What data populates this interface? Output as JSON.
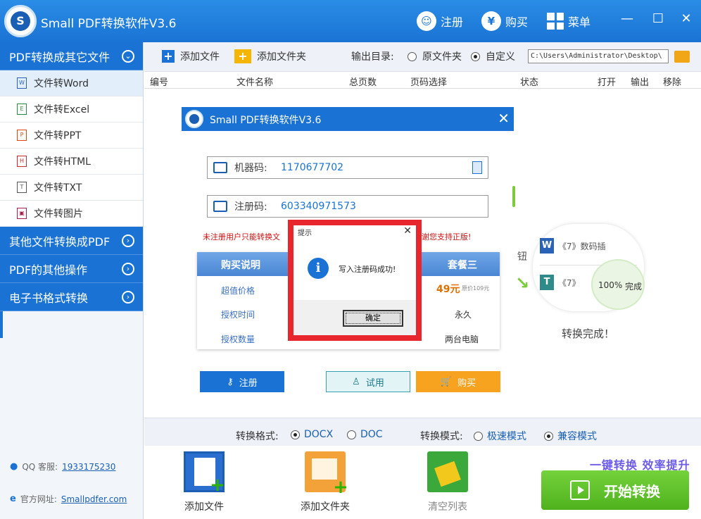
{
  "app": {
    "title": "Small PDF转换软件V3.6",
    "register_label": "注册",
    "buy_label": "购买",
    "menu_label": "菜单",
    "logo_letter": "S"
  },
  "sidebar": {
    "section_main": "PDF转换成其它文件",
    "items": [
      {
        "label": "文件转Word",
        "icon": "W"
      },
      {
        "label": "文件转Excel",
        "icon": "E"
      },
      {
        "label": "文件转PPT",
        "icon": "P"
      },
      {
        "label": "文件转HTML",
        "icon": "H"
      },
      {
        "label": "文件转TXT",
        "icon": "T"
      },
      {
        "label": "文件转图片",
        "icon": "▣"
      }
    ],
    "sections": [
      "其他文件转换成PDF",
      "PDF的其他操作",
      "电子书格式转换"
    ],
    "qq_label": "QQ 客服:",
    "qq_value": "1933175230",
    "site_label": "官方网址:",
    "site_value": "Smallpdfer.com"
  },
  "toolbar": {
    "add_file": "添加文件",
    "add_folder": "添加文件夹",
    "output_label": "输出目录:",
    "opt_source": "原文件夹",
    "opt_custom": "自定义",
    "path": "C:\\Users\\Administrator\\Desktop\\"
  },
  "columns": [
    "编号",
    "文件名称",
    "总页数",
    "页码选择",
    "状态",
    "打开",
    "输出",
    "移除"
  ],
  "register_dialog": {
    "title": "Small PDF转换软件V3.6",
    "machine_label": "机器码:",
    "machine_value": "1170677702",
    "reg_label": "注册码:",
    "reg_value": "603340971573",
    "warn_left": "未注册用户只能转换文",
    "warn_right": "感谢您支持正版!",
    "buy_header": "购买说明",
    "package_three": "套餐三",
    "row1_label": "超值价格",
    "row1_price": "49元",
    "row1_orig": "原价109元",
    "row2_label": "授权时间",
    "row2_value": "永久",
    "row3_label": "授权数量",
    "row3_value": "两台电脑",
    "btn_register": "注册",
    "btn_trial": "试用",
    "btn_buy": "购买"
  },
  "deco": {
    "btn_text": "钮",
    "row1": "《7》数码插",
    "row2": "《7》",
    "progress": "100%",
    "progress_state": "完成",
    "done": "转换完成！"
  },
  "message_box": {
    "title": "提示",
    "message": "写入注册码成功!",
    "ok": "确定"
  },
  "format_bar": {
    "format_label": "转换格式:",
    "docx": "DOCX",
    "doc": "DOC",
    "mode_label": "转换模式:",
    "fast": "极速模式",
    "compat": "兼容模式"
  },
  "bottom": {
    "add_file": "添加文件",
    "add_folder": "添加文件夹",
    "clear": "清空列表",
    "slogan": "一键转换  效率提升",
    "start": "开始转换"
  },
  "colors": {
    "brand_blue": "#1a73d4",
    "accent_red": "#e8262d",
    "start_green": "#5fc22a"
  }
}
